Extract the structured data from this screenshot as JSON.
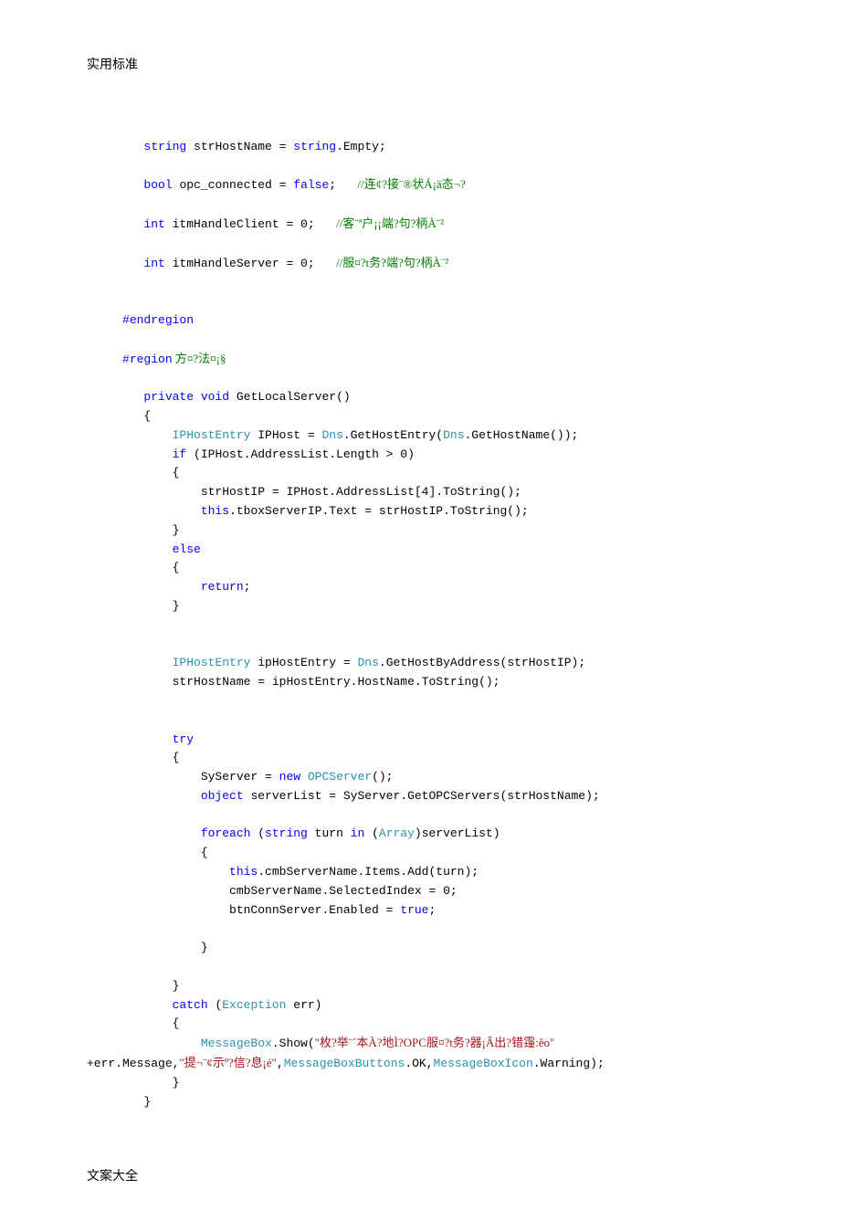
{
  "header": {
    "title": "实用标准"
  },
  "footer": {
    "text": "文案大全"
  },
  "code": {
    "line1_kw1": "string",
    "line1_var": " strHostName = ",
    "line1_kw2": "string",
    "line1_rest": ".Empty;",
    "line2_kw": "bool",
    "line2_var": " opc_connected = ",
    "line2_kw2": "false",
    "line2_semi": ";   ",
    "line2_cm": "//连¢?接¨®状Á¡ä态¬?",
    "line3_kw": "int",
    "line3_var": " itmHandleClient = 0;   ",
    "line3_cm": "//客¨ª户¡¡端?句?柄À¨²",
    "line4_kw": "int",
    "line4_var": " itmHandleServer = 0;   ",
    "line4_cm": "//服¤?t务?端?句?柄À¨²",
    "endregion": "#endregion",
    "region_pp": "#region",
    "region_name": " 方¤?法¤¡§",
    "m_priv": "private",
    "m_void": " void",
    "m_name": " GetLocalServer()",
    "brace_open": "{",
    "brace_close": "}",
    "l_iphe": "IPHostEntry",
    "l_iph_assign": " IPHost = ",
    "l_dns1": "Dns",
    "l_gethe": ".GetHostEntry(",
    "l_dns2": "Dns",
    "l_ghn": ".GetHostName());",
    "l_if": "if",
    "l_if_cond": " (IPHost.AddressList.Length > 0)",
    "l_ip_assign": "strHostIP = IPHost.AddressList[4].ToString();",
    "l_this1": "this",
    "l_tbox": ".tboxServerIP.Text = strHostIP.ToString();",
    "l_else": "else",
    "l_return": "return",
    "l_semi": ";",
    "l_iphe2": "IPHostEntry",
    "l_iphe2_assign": " ipHostEntry = ",
    "l_dns3": "Dns",
    "l_ghba": ".GetHostByAddress(strHostIP);",
    "l_hostname": "strHostName = ipHostEntry.HostName.ToString();",
    "l_try": "try",
    "l_sys_assign": "SyServer = ",
    "l_new": "new",
    "l_opcserver": " OPCServer",
    "l_opcserver_end": "();",
    "l_object": "object",
    "l_serverlist": " serverList = SyServer.GetOPCServers(strHostName);",
    "l_foreach": "foreach",
    "l_foreach_paren": " (",
    "l_string": "string",
    "l_turn_in": " turn ",
    "l_in": "in",
    "l_array_paren": " (",
    "l_array": "Array",
    "l_array_end": ")serverList)",
    "l_this2": "this",
    "l_cmb_add": ".cmbServerName.Items.Add(turn);",
    "l_cmb_sel": "cmbServerName.SelectedIndex = 0;",
    "l_btn_enable": "btnConnServer.Enabled = ",
    "l_true": "true",
    "l_catch": "catch",
    "l_exception": "Exception",
    "l_err": " err)",
    "l_catch_paren": " (",
    "l_mbox": "MessageBox",
    "l_show": ".Show(",
    "l_str1": "\"枚?举¨´本À?地Ì?OPC服¤?t务?器¡Â出?错䨪:êo\"",
    "l_plus": "+err.Message,",
    "l_str2": "\"提¬¨¢示º?信?息¡é\"",
    "l_comma": ",",
    "l_mbb": "MessageBoxButtons",
    "l_ok": ".OK,",
    "l_mbi": "MessageBoxIcon",
    "l_warn": ".Warning);"
  }
}
